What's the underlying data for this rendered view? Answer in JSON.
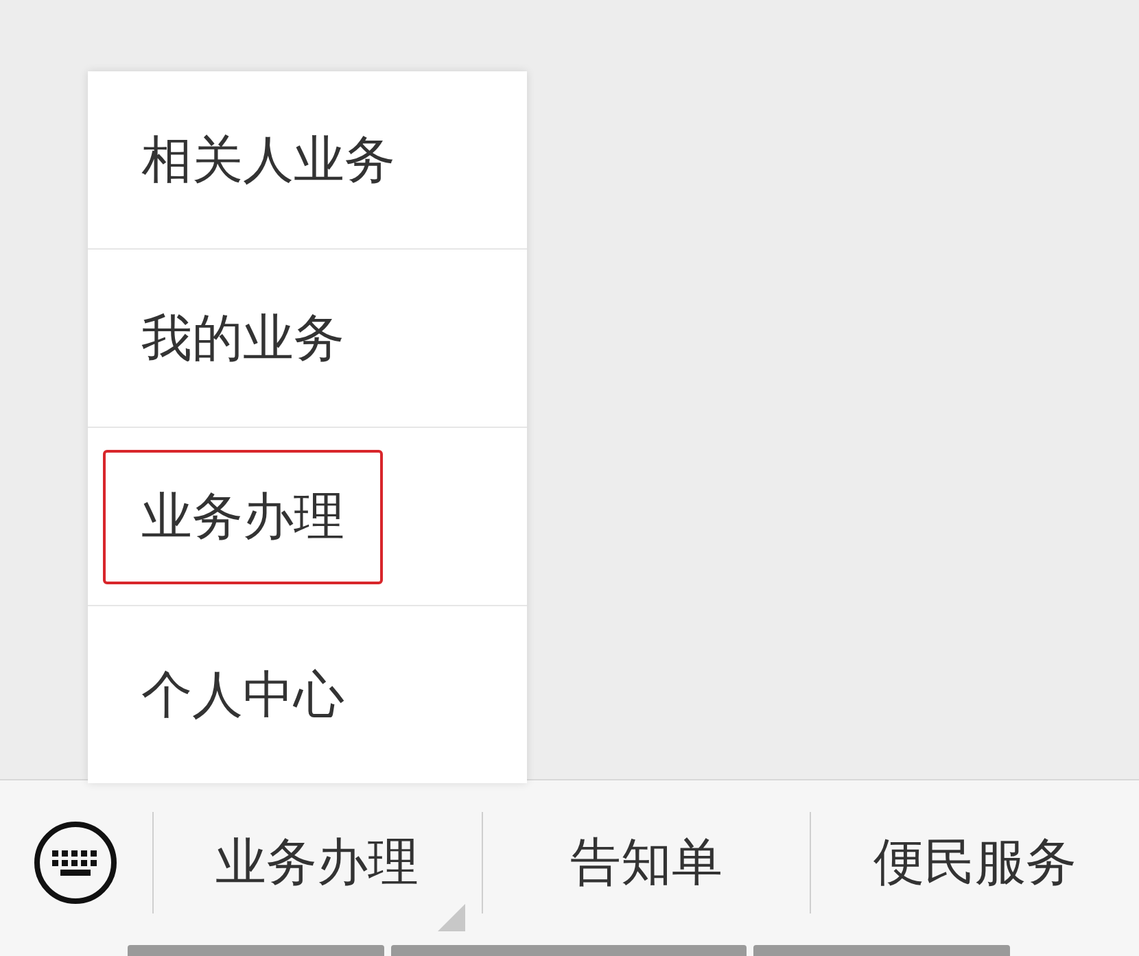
{
  "popup_menu": {
    "items": [
      {
        "label": "相关人业务",
        "highlighted": false
      },
      {
        "label": "我的业务",
        "highlighted": false
      },
      {
        "label": "业务办理",
        "highlighted": true
      },
      {
        "label": "个人中心",
        "highlighted": false
      }
    ]
  },
  "bottom_menu": {
    "tabs": [
      {
        "label": "业务办理",
        "has_submenu": true
      },
      {
        "label": "告知单",
        "has_submenu": false
      },
      {
        "label": "便民服务",
        "has_submenu": false
      }
    ]
  }
}
